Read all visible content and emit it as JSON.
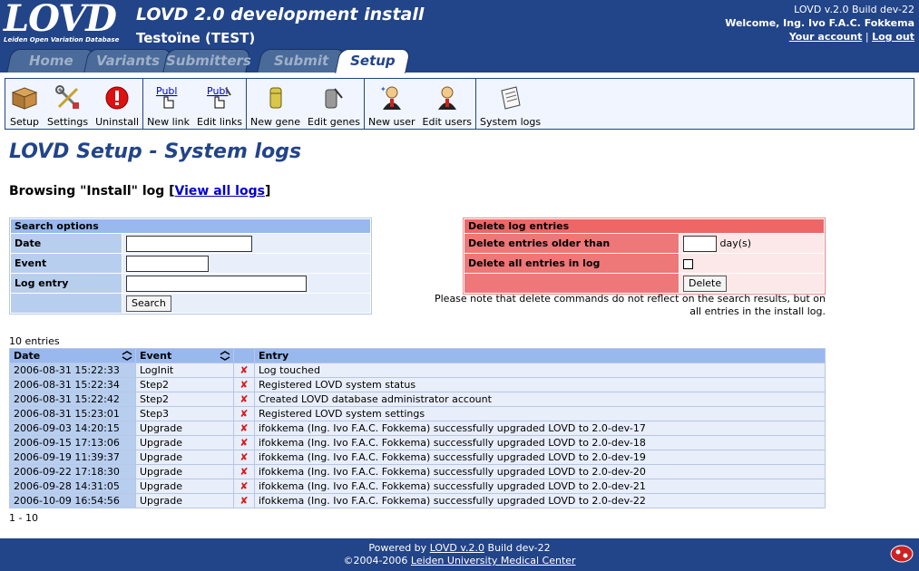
{
  "header": {
    "logo_text": "LOVD",
    "logo_subtext": "Leiden Open Variation Database",
    "title": "LOVD 2.0 development install",
    "subtitle": "Testoïne (TEST)",
    "version": "LOVD v.2.0 Build dev-22",
    "welcome": "Welcome, Ing. Ivo F.A.C. Fokkema",
    "your_account": "Your account",
    "separator": "|",
    "logout": "Log out"
  },
  "tabs": [
    {
      "label": "Home"
    },
    {
      "label": "Variants"
    },
    {
      "label": "Submitters"
    },
    {
      "label": "Submit"
    },
    {
      "label": "Setup",
      "active": true
    }
  ],
  "toolbar": {
    "setup": "Setup",
    "settings": "Settings",
    "uninstall": "Uninstall",
    "new_link": "New link",
    "edit_links": "Edit links",
    "new_gene": "New gene",
    "edit_genes": "Edit genes",
    "new_user": "New user",
    "edit_users": "Edit users",
    "system_logs": "System logs",
    "link_icon_text": "Publ"
  },
  "page": {
    "title": "LOVD Setup - System logs",
    "browse_prefix": "Browsing \"Install\" log [",
    "browse_link": "View all logs",
    "browse_suffix": "]"
  },
  "search": {
    "title": "Search options",
    "date_label": "Date",
    "event_label": "Event",
    "entry_label": "Log entry",
    "date_value": "",
    "event_value": "",
    "entry_value": "",
    "button": "Search"
  },
  "delete": {
    "title": "Delete log entries",
    "older_label": "Delete entries older than",
    "days_value": "",
    "days_unit": "day(s)",
    "all_label": "Delete all entries in log",
    "button": "Delete",
    "note_line1": "Please note that delete commands do not reflect on the search results, but on",
    "note_line2": "all entries in the install log."
  },
  "log": {
    "count": "10 entries",
    "range": "1 - 10",
    "columns": {
      "date": "Date",
      "event": "Event",
      "entry": "Entry"
    },
    "delete_glyph": "✘",
    "rows": [
      {
        "date": "2006-08-31 15:22:33",
        "event": "LogInit",
        "entry": "Log touched"
      },
      {
        "date": "2006-08-31 15:22:34",
        "event": "Step2",
        "entry": "Registered LOVD system status"
      },
      {
        "date": "2006-08-31 15:22:42",
        "event": "Step2",
        "entry": "Created LOVD database administrator account"
      },
      {
        "date": "2006-08-31 15:23:01",
        "event": "Step3",
        "entry": "Registered LOVD system settings"
      },
      {
        "date": "2006-09-03 14:20:15",
        "event": "Upgrade",
        "entry": "ifokkema (Ing. Ivo F.A.C. Fokkema) successfully upgraded LOVD to 2.0-dev-17"
      },
      {
        "date": "2006-09-15 17:13:06",
        "event": "Upgrade",
        "entry": "ifokkema (Ing. Ivo F.A.C. Fokkema) successfully upgraded LOVD to 2.0-dev-18"
      },
      {
        "date": "2006-09-19 11:39:37",
        "event": "Upgrade",
        "entry": "ifokkema (Ing. Ivo F.A.C. Fokkema) successfully upgraded LOVD to 2.0-dev-19"
      },
      {
        "date": "2006-09-22 17:18:30",
        "event": "Upgrade",
        "entry": "ifokkema (Ing. Ivo F.A.C. Fokkema) successfully upgraded LOVD to 2.0-dev-20"
      },
      {
        "date": "2006-09-28 14:31:05",
        "event": "Upgrade",
        "entry": "ifokkema (Ing. Ivo F.A.C. Fokkema) successfully upgraded LOVD to 2.0-dev-21"
      },
      {
        "date": "2006-10-09 16:54:56",
        "event": "Upgrade",
        "entry": "ifokkema (Ing. Ivo F.A.C. Fokkema) successfully upgraded LOVD to 2.0-dev-22"
      }
    ]
  },
  "footer": {
    "powered_prefix": "Powered by ",
    "powered_link": "LOVD v.2.0",
    "powered_suffix": " Build dev-22",
    "copyright_prefix": "©2004-2006 ",
    "copyright_link": "Leiden University Medical Center"
  },
  "colors": {
    "header_bg": "#224488",
    "search_header": "#99b8ee",
    "delete_header": "#ee6666",
    "delete_icon": "#d61c1c"
  },
  "icons": {
    "setup": "box-icon",
    "settings": "tools-icon",
    "uninstall": "stop-icon",
    "new_link": "new-link-icon",
    "edit_links": "edit-link-icon",
    "new_gene": "gene-icon",
    "edit_genes": "edit-gene-icon",
    "new_user": "new-user-icon",
    "edit_users": "edit-user-icon",
    "system_logs": "log-icon"
  }
}
